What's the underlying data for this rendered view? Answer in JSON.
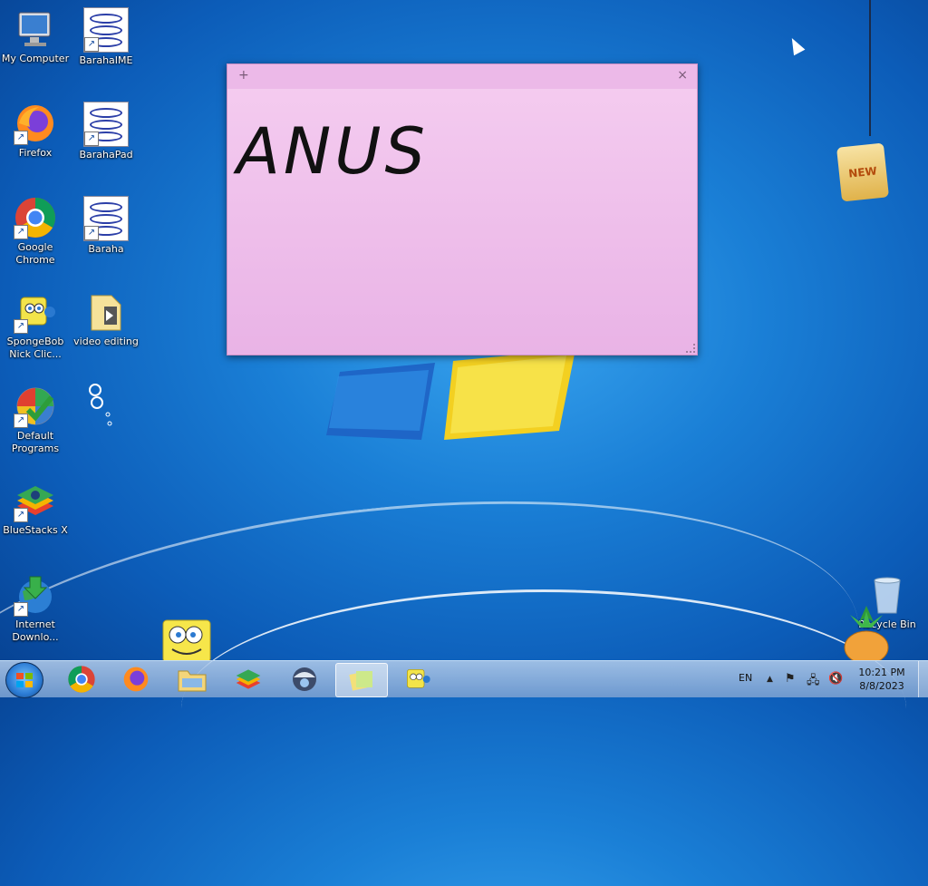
{
  "desktop_icons": {
    "my_computer": "My Computer",
    "baraha_ime": "BarahaIME",
    "firefox": "Firefox",
    "baraha_pad": "BarahaPad",
    "google_chrome": "Google Chrome",
    "baraha": "Baraha",
    "spongebob": "SpongeBob Nick Clic...",
    "video_editing": "video editing",
    "default_programs": "Default Programs",
    "bluestacks": "BlueStacks X",
    "internet_download": "Internet Downlo...",
    "recycle_bin": "Recycle Bin"
  },
  "sticky_note": {
    "add_label": "+",
    "close_label": "×",
    "text": "ANUS"
  },
  "gadget": {
    "tag_text": "NEW"
  },
  "taskbar": {
    "language": "EN",
    "time": "10:21 PM",
    "date": "8/8/2023"
  },
  "colors": {
    "note_bg": "#f0c2ec",
    "wallpaper": "#1a7fd6",
    "taskbar": "#9dbde3"
  }
}
